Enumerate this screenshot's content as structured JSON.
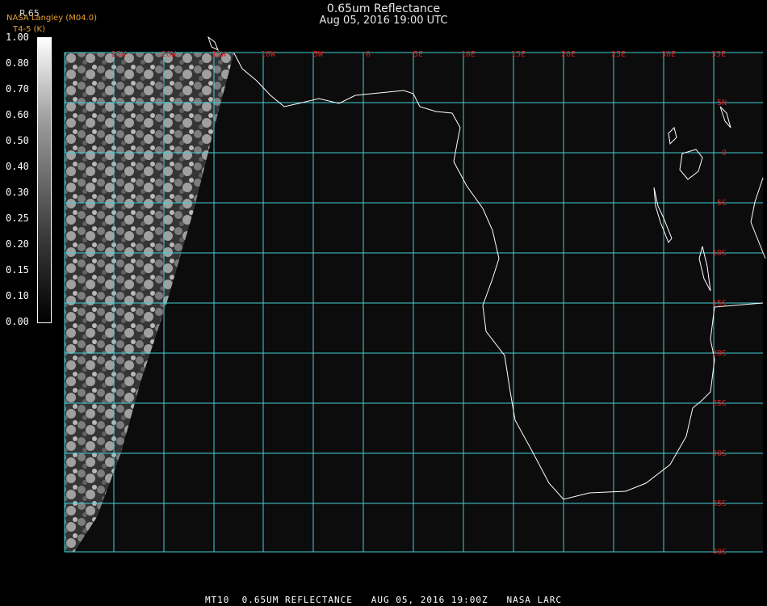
{
  "header": {
    "title": "0.65um Reflectance",
    "subtitle": "Aug 05, 2016 19:00 UTC",
    "credit": "NASA Langley (M04.0)",
    "credit_sub": "T4-5 (K)",
    "product_short": "R.65"
  },
  "colorbar": {
    "ticks": [
      "1.00",
      "0.80",
      "0.70",
      "0.60",
      "0.50",
      "0.40",
      "0.30",
      "0.25",
      "0.20",
      "0.15",
      "0.10",
      "0.00"
    ]
  },
  "map": {
    "lon_labels": [
      "25W",
      "20W",
      "15W",
      "10W",
      "5W",
      "0",
      "5E",
      "10E",
      "15E",
      "20E",
      "25E",
      "30E",
      "35E"
    ],
    "lat_labels": [
      "5N",
      "0",
      "5S",
      "10S",
      "15S",
      "20S",
      "25S",
      "30S",
      "35S",
      "40S"
    ],
    "grid_color": "#40d0d8",
    "coast_color": "#ffffff"
  },
  "footer": {
    "text": "MT10  0.65UM REFLECTANCE   AUG 05, 2016 19:00Z   NASA LARC"
  }
}
